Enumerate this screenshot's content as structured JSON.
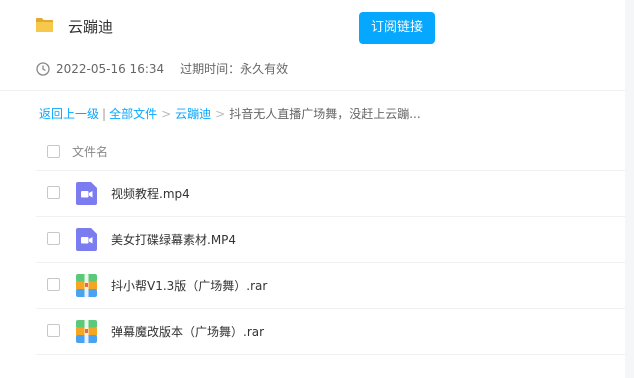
{
  "share": {
    "title": "云蹦迪",
    "subscribe_label": "订阅链接",
    "date": "2022-05-16 16:34",
    "expire_label": "过期时间：",
    "expire_value": "永久有效"
  },
  "breadcrumb": {
    "back": "返回上一级",
    "all_files": "全部文件",
    "folder": "云蹦迪",
    "current": "抖音无人直播广场舞，没赶上云蹦...",
    "separator": ">",
    "pipe": "|"
  },
  "table": {
    "header": "文件名",
    "files": [
      {
        "name": "视频教程.mp4",
        "icon": "video-file-icon"
      },
      {
        "name": "美女打碟绿幕素材.MP4",
        "icon": "video-file-icon"
      },
      {
        "name": "抖小帮V1.3版（广场舞）.rar",
        "icon": "archive-file-icon"
      },
      {
        "name": "弹幕魔改版本（广场舞）.rar",
        "icon": "archive-file-icon"
      }
    ]
  },
  "colors": {
    "accent": "#06a7ff",
    "video_icon": "#7b7cf0",
    "folder": "#f4c74a"
  }
}
